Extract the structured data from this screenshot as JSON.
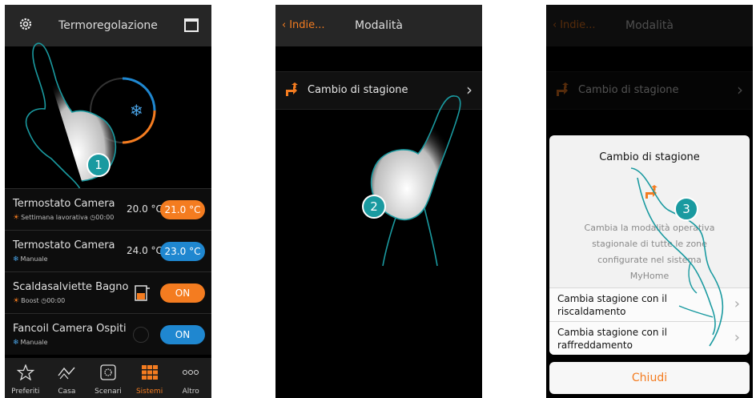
{
  "colors": {
    "accent": "#f47c20",
    "blue": "#1f87d0",
    "teal": "#1a9aa0"
  },
  "panel1": {
    "header_title": "Termoregolazione",
    "icons": {
      "settings": "gear-icon",
      "calendar": "calendar-icon"
    },
    "step": "1",
    "zones": [
      {
        "name": "Termostato Camera",
        "subtitle": "Settimana lavorativa",
        "time": "00:00",
        "mode": "sun",
        "setpoint": "20.0 °C",
        "pill": "21.0 °C",
        "pill_color": "orange"
      },
      {
        "name": "Termostato Camera",
        "subtitle": "Manuale",
        "time": "",
        "mode": "snow",
        "setpoint": "24.0 °C",
        "pill": "23.0 °C",
        "pill_color": "blue"
      },
      {
        "name": "Scaldasalviette Bagno",
        "subtitle": "Boost",
        "time": "00:00",
        "mode": "sun",
        "setpoint": "",
        "pill": "ON",
        "pill_color": "orange"
      },
      {
        "name": "Fancoil Camera Ospiti",
        "subtitle": "Manuale",
        "time": "",
        "mode": "snow",
        "setpoint": "",
        "pill": "ON",
        "pill_color": "blue"
      }
    ],
    "tabs": [
      {
        "label": "Preferiti",
        "icon": "star-icon",
        "active": false
      },
      {
        "label": "Casa",
        "icon": "house-icon",
        "active": false
      },
      {
        "label": "Scenari",
        "icon": "scenario-icon",
        "active": false
      },
      {
        "label": "Sistemi",
        "icon": "grid-icon",
        "active": true
      },
      {
        "label": "Altro",
        "icon": "more-icon",
        "active": false
      }
    ]
  },
  "panel2": {
    "back_label": "Indie...",
    "header_title": "Modalità",
    "row_label": "Cambio di stagione",
    "step": "2"
  },
  "panel3": {
    "back_label": "Indie...",
    "header_title": "Modalità",
    "row_label": "Cambio di stagione",
    "step": "3",
    "dialog": {
      "title": "Cambio di stagione",
      "description_lines": [
        "Cambia la modalità operativa",
        "stagionale di tutte le zone",
        "configurate nel sistema",
        "MyHome"
      ],
      "option1_line1": "Cambia stagione con il",
      "option1_line2": "riscaldamento",
      "option2_line1": "Cambia stagione con il",
      "option2_line2": "raffreddamento",
      "close_label": "Chiudi"
    }
  }
}
